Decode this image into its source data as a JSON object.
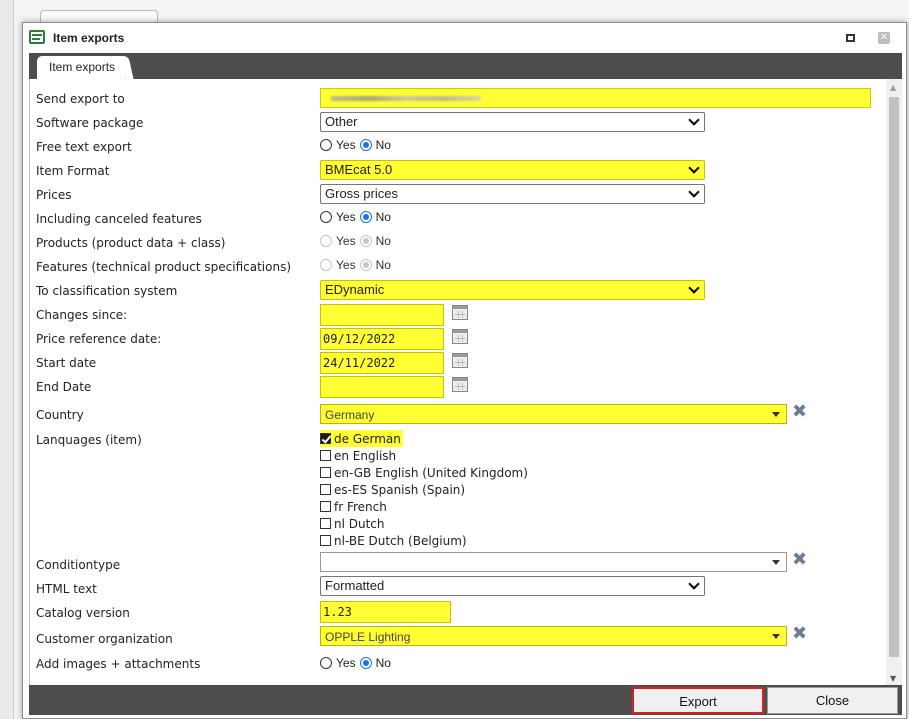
{
  "dialog": {
    "title": "Item exports",
    "tab": "Item exports"
  },
  "form": {
    "send_export_to": {
      "label": "Send export to",
      "value": ""
    },
    "software_package": {
      "label": "Software package",
      "value": "Other"
    },
    "free_text_export": {
      "label": "Free text export",
      "yes": "Yes",
      "no": "No",
      "selected": "No"
    },
    "item_format": {
      "label": "Item Format",
      "value": "BMEcat 5.0"
    },
    "prices": {
      "label": "Prices",
      "value": "Gross prices"
    },
    "including_canceled": {
      "label": "Including canceled features",
      "yes": "Yes",
      "no": "No",
      "selected": "No"
    },
    "products": {
      "label": "Products (product data + class)",
      "yes": "Yes",
      "no": "No",
      "selected": "No",
      "disabled": true
    },
    "features": {
      "label": "Features (technical product specifications)",
      "yes": "Yes",
      "no": "No",
      "selected": "No",
      "disabled": true
    },
    "classification": {
      "label": "To classification system",
      "value": "EDynamic"
    },
    "changes_since": {
      "label": "Changes since:",
      "value": ""
    },
    "price_reference_date": {
      "label": "Price reference date:",
      "value": "09/12/2022"
    },
    "start_date": {
      "label": "Start date",
      "value": "24/11/2022"
    },
    "end_date": {
      "label": "End Date",
      "value": ""
    },
    "country": {
      "label": "Country",
      "value": "Germany"
    },
    "languages": {
      "label": "Lanquages (item)",
      "options": [
        {
          "label": "de German",
          "checked": true
        },
        {
          "label": "en English",
          "checked": false
        },
        {
          "label": "en-GB English (United Kingdom)",
          "checked": false
        },
        {
          "label": "es-ES Spanish (Spain)",
          "checked": false
        },
        {
          "label": "fr French",
          "checked": false
        },
        {
          "label": "nl Dutch",
          "checked": false
        },
        {
          "label": "nl-BE Dutch (Belgium)",
          "checked": false
        }
      ]
    },
    "conditiontype": {
      "label": "Conditiontype",
      "value": ""
    },
    "html_text": {
      "label": "HTML text",
      "value": "Formatted"
    },
    "catalog_version": {
      "label": "Catalog version",
      "value": "1.23"
    },
    "customer_org": {
      "label": "Customer organization",
      "value": "OPPLE Lighting"
    },
    "add_images": {
      "label": "Add images + attachments",
      "yes": "Yes",
      "no": "No",
      "selected": "No"
    }
  },
  "footer": {
    "export": "Export",
    "close": "Close"
  },
  "colors": {
    "highlight": "#ffff33",
    "bar": "#4d4d4d",
    "radio_selected": "#1a73e8",
    "export_border": "#d42121"
  },
  "icons": [
    "form-icon",
    "maximize-icon",
    "close-icon",
    "calendar-icon",
    "clear-icon",
    "chevron-down-icon"
  ]
}
